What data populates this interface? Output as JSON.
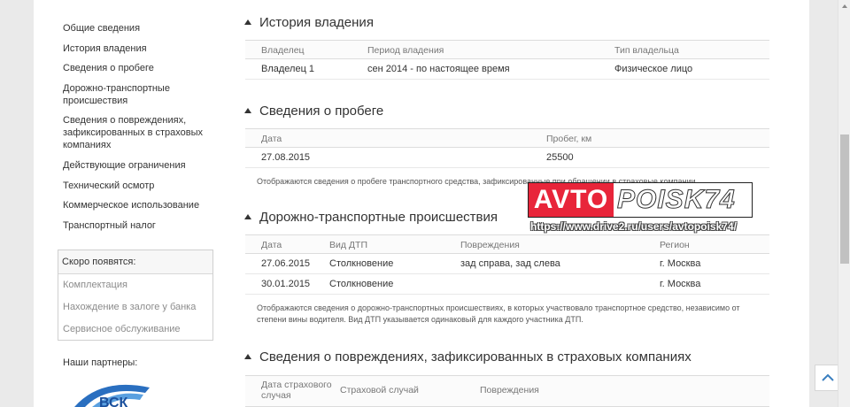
{
  "sidebar": {
    "items": [
      {
        "label": "Общие сведения"
      },
      {
        "label": "История владения"
      },
      {
        "label": "Сведения о пробеге"
      },
      {
        "label": "Дорожно-транспортные происшествия"
      },
      {
        "label": "Сведения о повреждениях, зафиксированных в страховых компаниях"
      },
      {
        "label": "Действующие ограничения"
      },
      {
        "label": "Технический осмотр"
      },
      {
        "label": "Коммерческое использование"
      },
      {
        "label": "Транспортный налог"
      }
    ],
    "soon": {
      "title": "Скоро появятся:",
      "items": [
        "Комплектация",
        "Нахождение в залоге у банка",
        "Сервисное обслуживание"
      ]
    },
    "partners_title": "Наши партнеры:",
    "partner_logo_text": "ВСК"
  },
  "ownership": {
    "title": "История владения",
    "headers": [
      "Владелец",
      "Период владения",
      "Тип владельца"
    ],
    "rows": [
      [
        "Владелец 1",
        "сен 2014 - по настоящее время",
        "Физическое лицо"
      ]
    ]
  },
  "mileage": {
    "title": "Сведения о пробеге",
    "headers": [
      "Дата",
      "Пробег, км"
    ],
    "rows": [
      [
        "27.08.2015",
        "25500"
      ]
    ],
    "note": "Отображаются сведения о пробеге транспортного средства, зафиксированные при обращении в страховые компании."
  },
  "accidents": {
    "title": "Дорожно-транспортные происшествия",
    "headers": [
      "Дата",
      "Вид ДТП",
      "Повреждения",
      "Регион"
    ],
    "rows": [
      [
        "27.06.2015",
        "Столкновение",
        "зад справа, зад слева",
        "г. Москва"
      ],
      [
        "30.01.2015",
        "Столкновение",
        "",
        "г. Москва"
      ]
    ],
    "note": "Отображаются сведения о дорожно-транспортных происшествиях, в которых участвовало транспортное средство, независимо от степени вины водителя. Вид ДТП указывается одинаковый для каждого участника ДТП."
  },
  "damages": {
    "title": "Сведения о повреждениях, зафиксированных в страховых компаниях",
    "headers": [
      "Дата страхового случая",
      "Страховой случай",
      "Повреждения"
    ]
  },
  "watermark": {
    "part1": "AVTO",
    "part2": "POISK74",
    "url": "https://www.drive2.ru/users/avtopoisk74/"
  },
  "colors": {
    "watermark_red": "#e8253a",
    "logo_blue": "#1a4f9c",
    "background": "#eaeaea"
  },
  "icons": {
    "section_arrow": "triangle-up-icon",
    "scroll_top": "chevron-up-icon"
  }
}
